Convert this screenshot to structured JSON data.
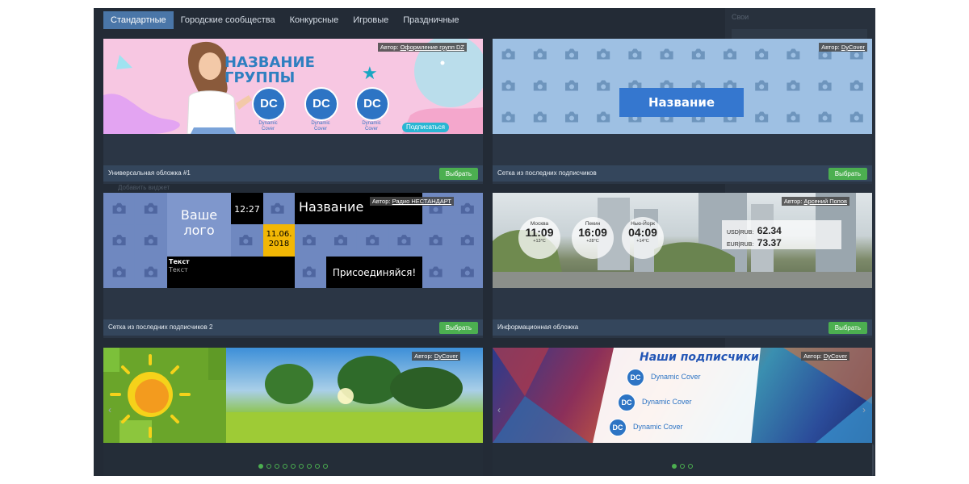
{
  "tabs": [
    "Стандартные",
    "Городские сообщества",
    "Конкурсные",
    "Игровые",
    "Праздничные"
  ],
  "active_tab": 0,
  "bg_labels": {
    "top_right": "Свои",
    "left_mid": "Добавить виджет"
  },
  "cards": [
    {
      "title": "Универсальная обложка #1",
      "button": "Выбрать",
      "author_prefix": "Автор:",
      "author": "Оформление групп DZ",
      "banner": {
        "heading": "НАЗВАНИЕ",
        "heading2": "ГРУППЫ",
        "logo_text": "DC",
        "logo_sub": "Dynamic Cover",
        "subscribe": "Подписаться"
      }
    },
    {
      "title": "Сетка из последних подписчиков",
      "button": "Выбрать",
      "author_prefix": "Автор:",
      "author": "DyCover",
      "banner": {
        "name_box": "Название"
      }
    },
    {
      "title": "Сетка из последних подписчиков 2",
      "button": "Выбрать",
      "author_prefix": "Автор:",
      "author": "Радио НЕСТАНДАРТ",
      "banner": {
        "logo_l1": "Ваше",
        "logo_l2": "лого",
        "time": "12:27",
        "date_l1": "11.06.",
        "date_l2": "2018",
        "name": "Название",
        "text_title": "Текст",
        "text_sub": "Текст",
        "join": "Присоединяйся!"
      }
    },
    {
      "title": "Информационная обложка",
      "button": "Выбрать",
      "author_prefix": "Автор:",
      "author": "Арсений Попов",
      "banner": {
        "cities": [
          {
            "name": "Москва",
            "time": "11:09",
            "temp": "+13°C"
          },
          {
            "name": "Пекин",
            "time": "16:09",
            "temp": "+28°C"
          },
          {
            "name": "Нью-Йорк",
            "time": "04:09",
            "temp": "+14°C"
          }
        ],
        "rates": [
          {
            "pair": "USD|RUB:",
            "value": "62.34"
          },
          {
            "pair": "EUR|RUB:",
            "value": "73.37"
          }
        ]
      }
    },
    {
      "author_prefix": "Автор:",
      "author": "DyCover",
      "dots": 9,
      "active_dot": 0
    },
    {
      "author_prefix": "Автор:",
      "author": "DyCover",
      "banner": {
        "heading": "Наши подписчики",
        "rows": [
          "Dynamic Cover",
          "Dynamic Cover",
          "Dynamic Cover"
        ],
        "logo_text": "DC"
      },
      "dots": 3,
      "active_dot": 0
    }
  ]
}
